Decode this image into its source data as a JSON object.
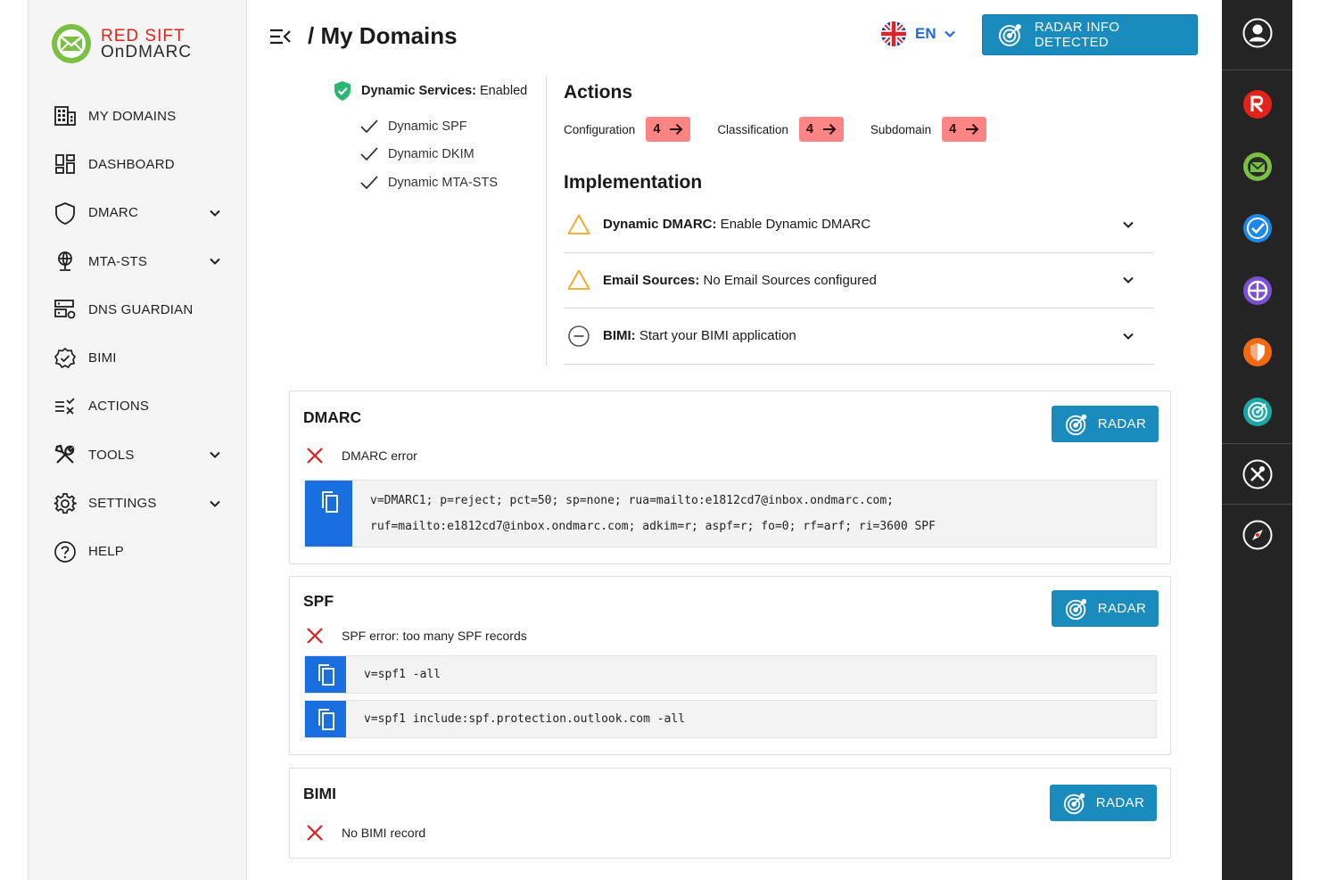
{
  "brand": {
    "line1": "RED SIFT",
    "line2": "OnDMARC"
  },
  "sidebar": {
    "items": [
      {
        "label": "MY DOMAINS",
        "icon": "building-icon",
        "expandable": false
      },
      {
        "label": "DASHBOARD",
        "icon": "dashboard-icon",
        "expandable": false
      },
      {
        "label": "DMARC",
        "icon": "shield-icon",
        "expandable": true
      },
      {
        "label": "MTA-STS",
        "icon": "globe-pin-icon",
        "expandable": true
      },
      {
        "label": "DNS GUARDIAN",
        "icon": "server-icon",
        "expandable": false
      },
      {
        "label": "BIMI",
        "icon": "verified-badge-icon",
        "expandable": false
      },
      {
        "label": "ACTIONS",
        "icon": "actions-list-icon",
        "expandable": false
      },
      {
        "label": "TOOLS",
        "icon": "tools-icon",
        "expandable": true
      },
      {
        "label": "SETTINGS",
        "icon": "gear-icon",
        "expandable": true
      },
      {
        "label": "HELP",
        "icon": "help-icon",
        "expandable": false
      }
    ]
  },
  "header": {
    "title_prefix": "/ ",
    "title": "My Domains",
    "language": "EN",
    "radar_button": "RADAR INFO DETECTED"
  },
  "dynamic_services": {
    "label": "Dynamic Services:",
    "status": "Enabled",
    "items": [
      "Dynamic SPF",
      "Dynamic DKIM",
      "Dynamic MTA-STS"
    ]
  },
  "actions": {
    "title": "Actions",
    "groups": [
      {
        "label": "Configuration",
        "count": "4"
      },
      {
        "label": "Classification",
        "count": "4"
      },
      {
        "label": "Subdomain",
        "count": "4"
      }
    ]
  },
  "implementation": {
    "title": "Implementation",
    "items": [
      {
        "key": "Dynamic DMARC:",
        "text": " Enable Dynamic DMARC",
        "status": "warning"
      },
      {
        "key": "Email Sources:",
        "text": " No Email Sources configured",
        "status": "warning"
      },
      {
        "key": "BIMI:",
        "text": " Start your BIMI application",
        "status": "neutral"
      }
    ]
  },
  "records": {
    "dmarc": {
      "title": "DMARC",
      "radar": "RADAR",
      "error": "DMARC error",
      "lines": [
        "v=DMARC1; p=reject; pct=50; sp=none; rua=mailto:e1812cd7@inbox.ondmarc.com;",
        "ruf=mailto:e1812cd7@inbox.ondmarc.com; adkim=r; aspf=r; fo=0; rf=arf; ri=3600 SPF"
      ]
    },
    "spf": {
      "title": "SPF",
      "radar": "RADAR",
      "error": "SPF error: too many SPF records",
      "records": [
        "v=spf1 -all",
        "v=spf1 include:spf.protection.outlook.com -all"
      ]
    },
    "bimi": {
      "title": "BIMI",
      "radar": "RADAR",
      "error": "No BIMI record"
    }
  },
  "colors": {
    "accent": "#1a8bbd",
    "copy": "#1a6fe0",
    "badge": "#ff8585",
    "error": "#e02020",
    "warning": "#f4a621",
    "shield_ok": "#2bb673",
    "rail": "#242424"
  },
  "rail": [
    "user-icon",
    "redsift-r-icon",
    "ondmarc-icon",
    "certificates-icon",
    "brand-trust-icon",
    "asm-shield-icon",
    "radar-icon",
    "tools-x-icon",
    "compass-icon"
  ]
}
